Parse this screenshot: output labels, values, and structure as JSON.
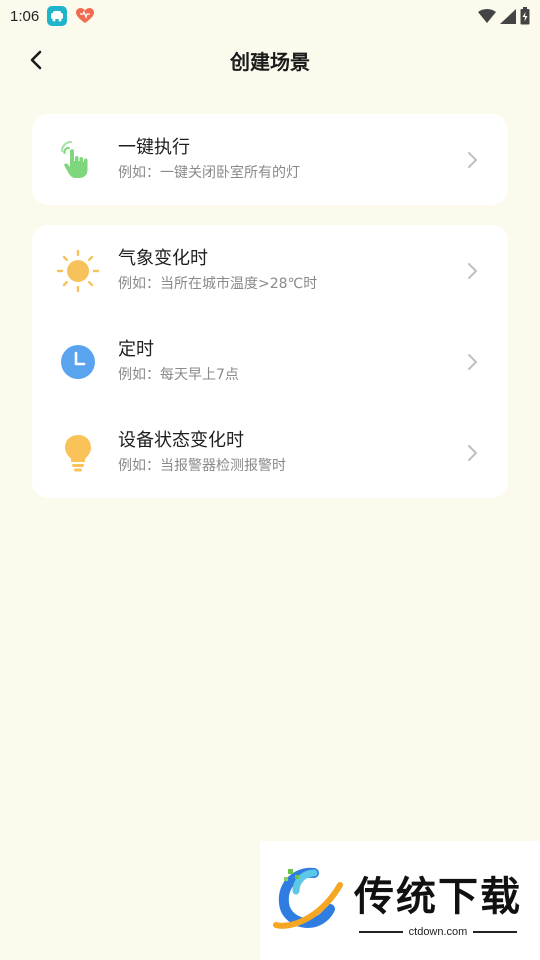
{
  "status_bar": {
    "time": "1:06"
  },
  "header": {
    "title": "创建场景"
  },
  "cards": [
    {
      "rows": [
        {
          "icon": "hand-tap-icon",
          "title": "一键执行",
          "subtitle": "例如：一键关闭卧室所有的灯"
        }
      ]
    },
    {
      "rows": [
        {
          "icon": "sun-icon",
          "title": "气象变化时",
          "subtitle": "例如：当所在城市温度>28℃时"
        },
        {
          "icon": "clock-icon",
          "title": "定时",
          "subtitle": "例如：每天早上7点"
        },
        {
          "icon": "lightbulb-icon",
          "title": "设备状态变化时",
          "subtitle": "例如：当报警器检测报警时"
        }
      ]
    }
  ],
  "watermark": {
    "title": "传统下载",
    "url": "ctdown.com"
  },
  "colors": {
    "background": "#fbfaed",
    "card": "#ffffff",
    "hand_green": "#7ed67d",
    "sun_yellow": "#f7c25b",
    "clock_blue": "#5aa4ef",
    "bulb_yellow": "#f9c35a"
  }
}
